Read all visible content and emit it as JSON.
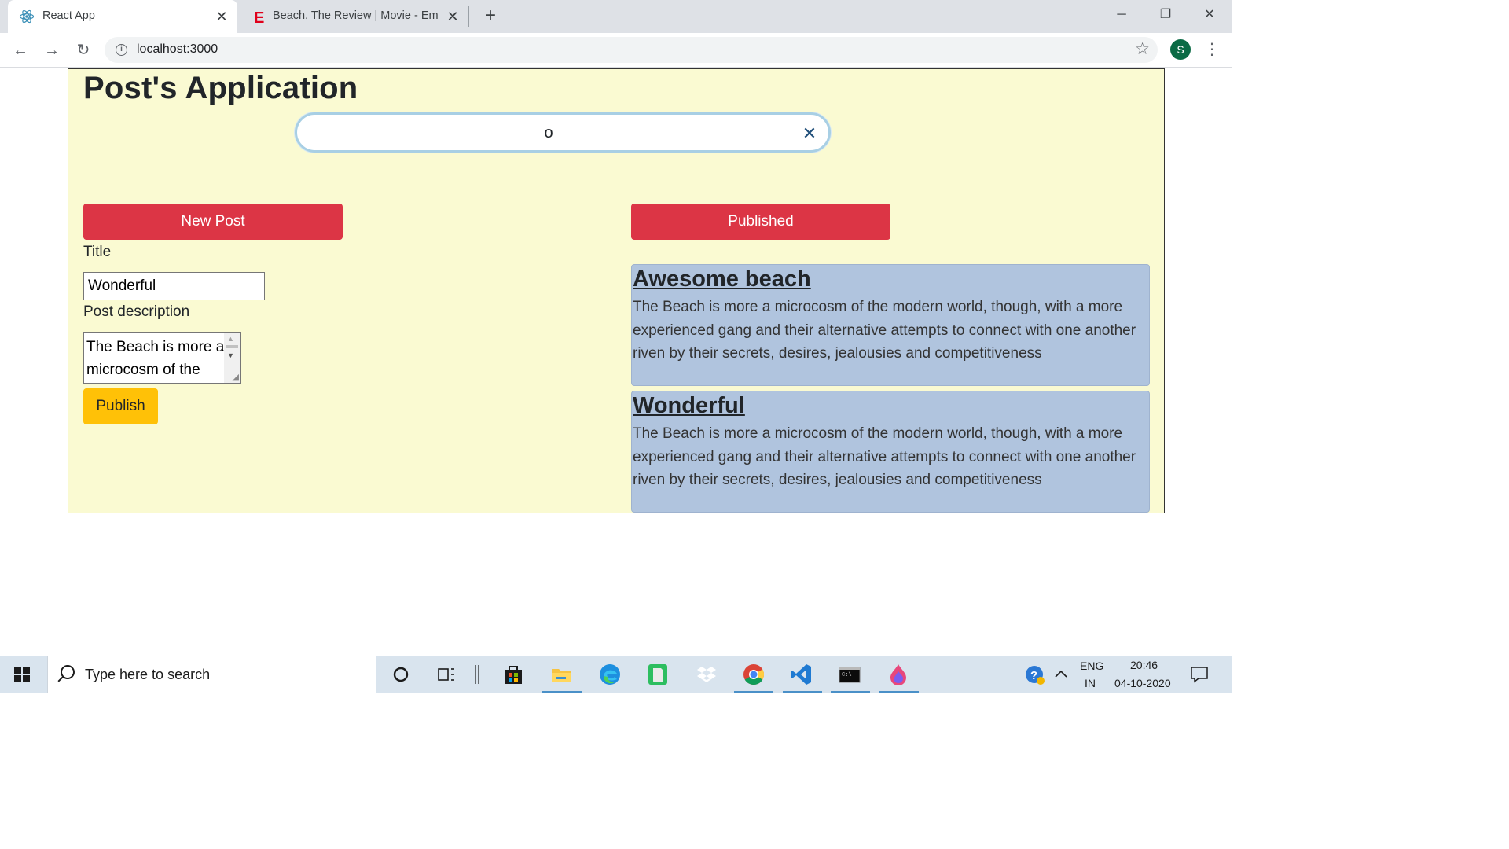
{
  "browser": {
    "tabs": [
      {
        "title": "React App",
        "favicon": "react-icon",
        "active": true
      },
      {
        "title": "Beach, The Review | Movie - Empire",
        "favicon": "empire-e-icon",
        "active": false
      }
    ],
    "url": "localhost:3000",
    "profile_initial": "S"
  },
  "app": {
    "title": "Post's Application",
    "search": {
      "value": "o",
      "placeholder": ""
    },
    "new_post_label": "New Post",
    "published_label": "Published",
    "form": {
      "title_label": "Title",
      "title_value": "Wonderful",
      "description_label": "Post description",
      "description_value": "The Beach is more a microcosm of the",
      "publish_label": "Publish"
    },
    "posts": [
      {
        "title": "Awesome beach",
        "body": "The Beach is more a microcosm of the modern world, though, with a more experienced gang and their alternative attempts to connect with one another riven by their secrets, desires, jealousies and competitiveness"
      },
      {
        "title": "Wonderful",
        "body": "The Beach is more a microcosm of the modern world, though, with a more experienced gang and their alternative attempts to connect with one another riven by their secrets, desires, jealousies and competitiveness"
      }
    ],
    "colors": {
      "page_bg": "#fafad2",
      "red_button": "#dc3545",
      "publish_button": "#ffc107",
      "post_card": "#b0c4de"
    }
  },
  "taskbar": {
    "search_placeholder": "Type here to search",
    "language": "ENG",
    "region": "IN",
    "time": "20:46",
    "date": "04-10-2020",
    "pinned": [
      "cortana-icon",
      "task-view-icon",
      "store-icon",
      "file-explorer-icon",
      "edge-icon",
      "evernote-icon",
      "dropbox-icon",
      "chrome-icon",
      "vscode-icon",
      "terminal-icon",
      "paint-icon"
    ]
  }
}
